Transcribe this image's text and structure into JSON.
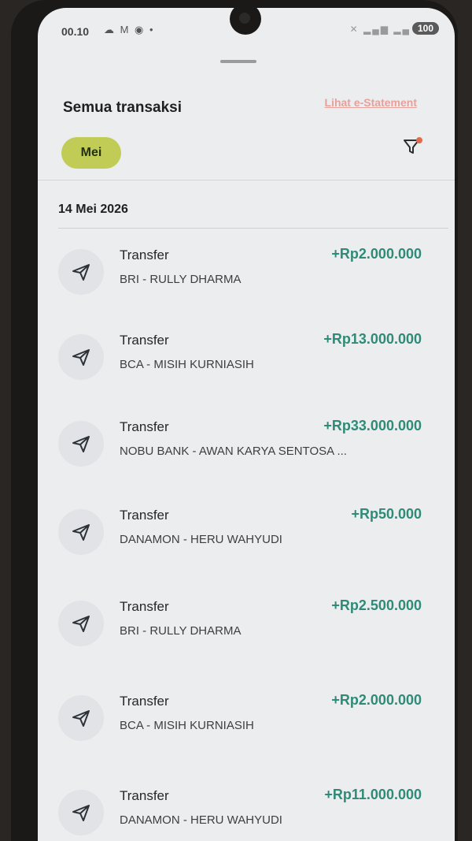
{
  "status_bar": {
    "time": "00.10",
    "left_icons": "☁ M ◉ •",
    "right_icons": "✕ ▂▄▆ ▂▄",
    "battery": "100"
  },
  "header": {
    "title": "Semua transaksi",
    "estatement_link": "Lihat e-Statement"
  },
  "filter": {
    "month_chip": "Mei",
    "icon": "filter-icon"
  },
  "colors": {
    "accent_chip": "#c0cc55",
    "amount_positive": "#2f8a78",
    "link": "#e8a09a"
  },
  "date_group": "14 Mei 2026",
  "transactions": [
    {
      "title": "Transfer",
      "desc": "BRI - RULLY DHARMA",
      "amount": "+Rp2.000.000",
      "icon": "send-icon"
    },
    {
      "title": "Transfer",
      "desc": "BCA - MISIH KURNIASIH",
      "amount": "+Rp13.000.000",
      "icon": "send-icon"
    },
    {
      "title": "Transfer",
      "desc": "NOBU BANK - AWAN KARYA SENTOSA ...",
      "amount": "+Rp33.000.000",
      "icon": "send-icon"
    },
    {
      "title": "Transfer",
      "desc": "DANAMON - HERU WAHYUDI",
      "amount": "+Rp50.000",
      "icon": "send-icon"
    },
    {
      "title": "Transfer",
      "desc": "BRI - RULLY DHARMA",
      "amount": "+Rp2.500.000",
      "icon": "send-icon"
    },
    {
      "title": "Transfer",
      "desc": "BCA - MISIH KURNIASIH",
      "amount": "+Rp2.000.000",
      "icon": "send-icon"
    },
    {
      "title": "Transfer",
      "desc": "DANAMON - HERU WAHYUDI",
      "amount": "+Rp11.000.000",
      "icon": "send-icon"
    }
  ]
}
